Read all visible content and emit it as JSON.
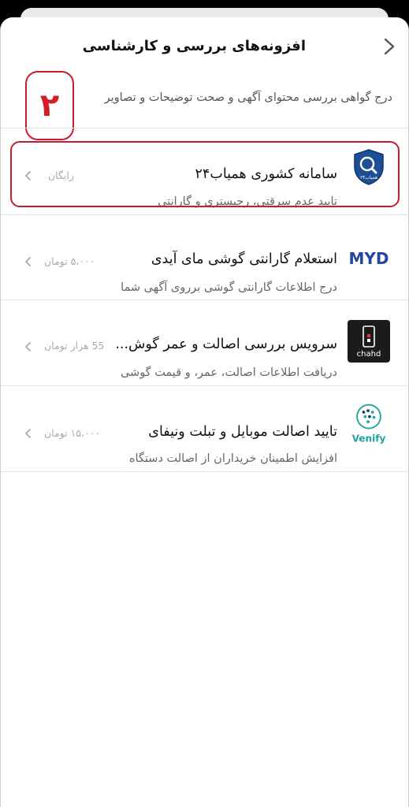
{
  "header": {
    "title": "افزونه‌های بررسی و کارشناسی",
    "subtitle": "درج گواهی بررسی محتوای آگهی و صحت توضیحات و تصاویر"
  },
  "annotation": {
    "step_number": "۲"
  },
  "items": [
    {
      "title": "سامانه کشوری همیاب۲۴",
      "description": "تایید عدم سرقتی، رجیستری و گارانتی",
      "price": "رایگان",
      "logo_text": "همیاب۲۴",
      "logo_icon": "hamyab-shield-icon"
    },
    {
      "title": "استعلام گارانتی گوشی مای آیدی",
      "description": "درج اطلاعات گارانتی گوشی برروی آگهی شما",
      "price": "۵،۰۰۰ تومان",
      "logo_text": "MYD",
      "logo_icon": "myd-logo-icon"
    },
    {
      "title": "سرویس بررسی اصالت و عمر گوش...",
      "description": "دریافت اطلاعات اصالت، عمر، و قیمت گوشی",
      "price": "55 هزار تومان",
      "logo_text": "chahd",
      "logo_icon": "chahd-logo-icon"
    },
    {
      "title": "تایید اصالت موبایل و تبلت ونیفای",
      "description": "افزایش اطمینان خریداران از اصالت دستگاه",
      "price": "۱۵،۰۰۰ تومان",
      "logo_text": "Venify",
      "logo_icon": "venify-logo-icon"
    }
  ],
  "colors": {
    "accent_red": "#c81e2c",
    "hamyab_blue": "#1c4f95",
    "myd_blue": "#2346a6",
    "venify_teal": "#1ea49a"
  }
}
